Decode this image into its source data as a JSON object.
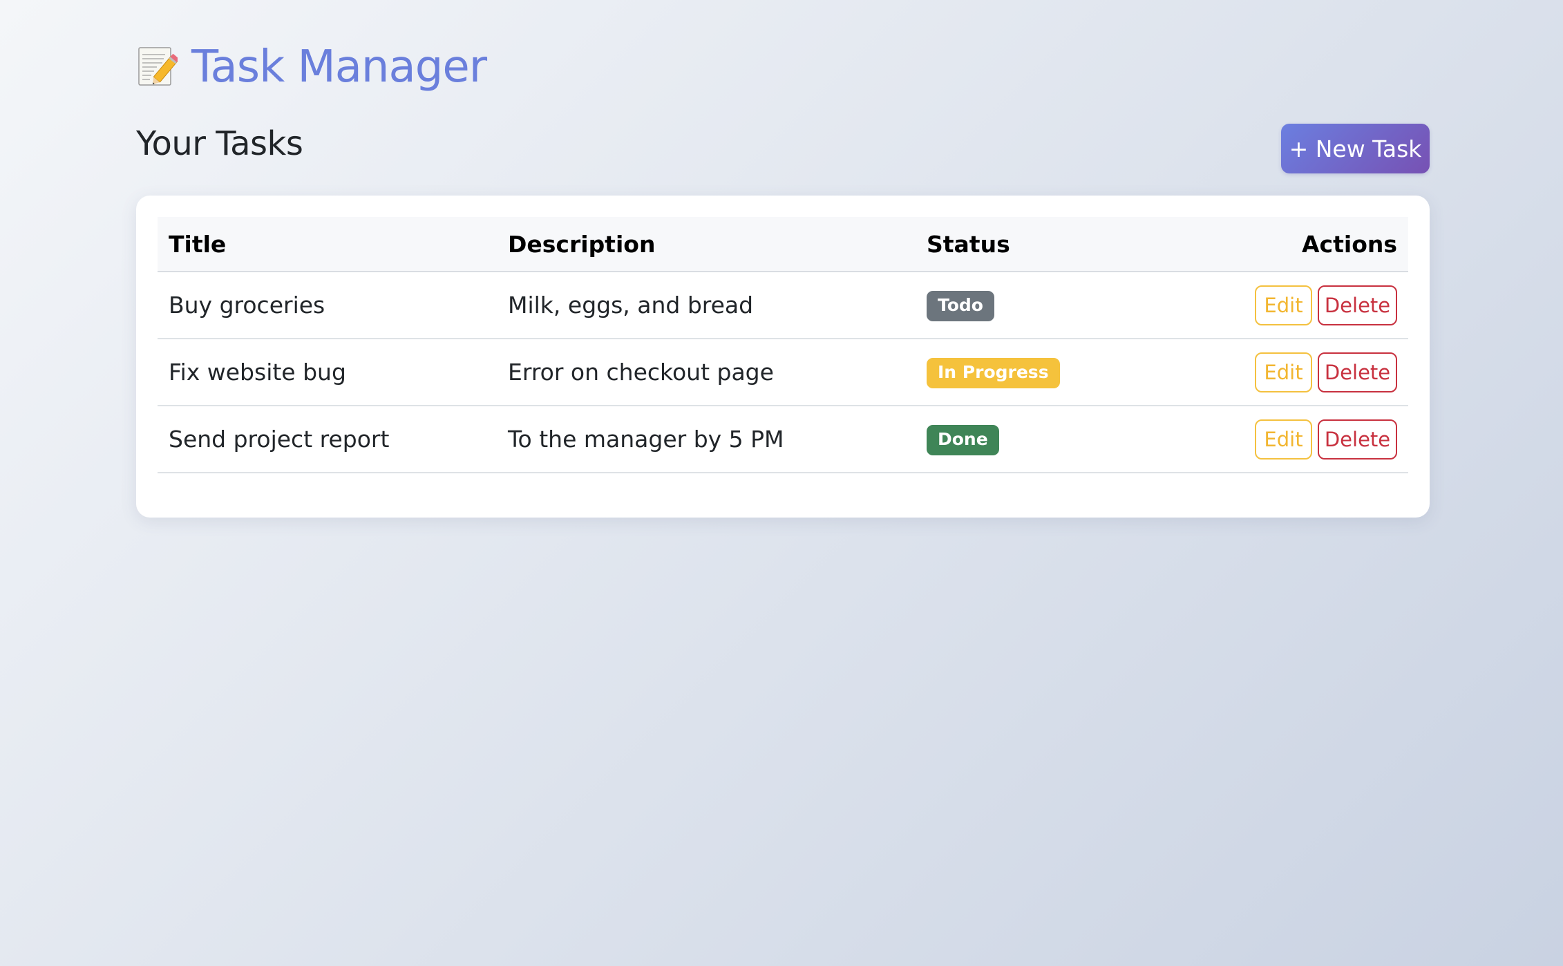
{
  "app": {
    "title": "Task Manager",
    "icon": "memo-pencil-icon"
  },
  "section": {
    "title": "Your Tasks",
    "new_task_label": "+ New Task"
  },
  "table": {
    "headers": {
      "title": "Title",
      "description": "Description",
      "status": "Status",
      "actions": "Actions"
    },
    "rows": [
      {
        "title": "Buy groceries",
        "description": "Milk, eggs, and bread",
        "status": "Todo",
        "status_color": "#6c757d",
        "edit_label": "Edit",
        "delete_label": "Delete"
      },
      {
        "title": "Fix website bug",
        "description": "Error on checkout page",
        "status": "In Progress",
        "status_color": "#f5c23c",
        "edit_label": "Edit",
        "delete_label": "Delete"
      },
      {
        "title": "Send project report",
        "description": "To the manager by 5 PM",
        "status": "Done",
        "status_color": "#3f8557",
        "edit_label": "Edit",
        "delete_label": "Delete"
      }
    ]
  },
  "colors": {
    "title_accent": "#6a7fdc",
    "button_gradient_start": "#6b7fe0",
    "button_gradient_end": "#7751b3",
    "edit_color": "#f2b630",
    "delete_color": "#c8313f"
  }
}
